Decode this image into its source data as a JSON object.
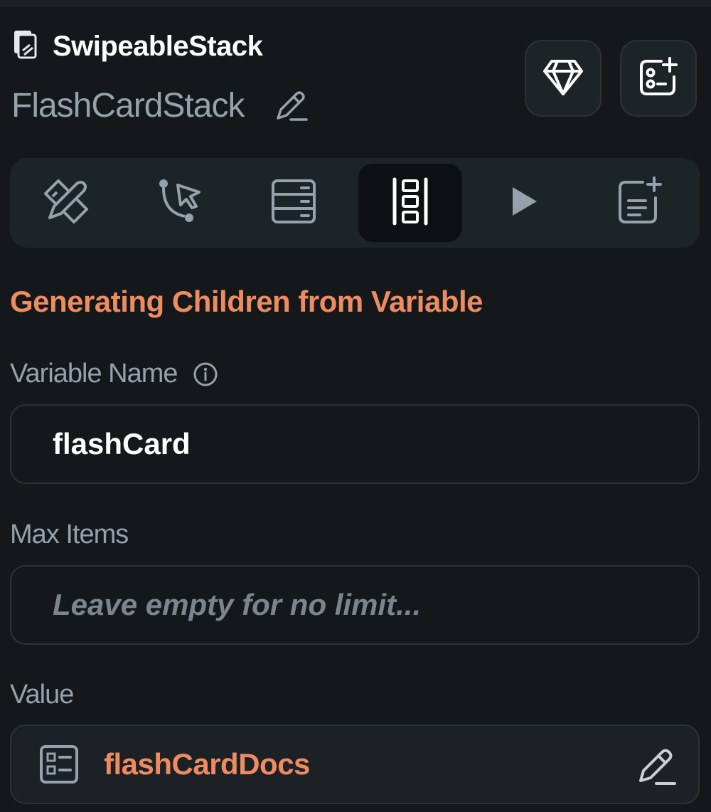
{
  "header": {
    "widget_type": "SwipeableStack",
    "widget_name": "FlashCardStack",
    "widget_type_icon": "swipeable-stack-icon",
    "rename_icon": "pencil-icon",
    "buttons": [
      {
        "icon": "diamond-icon"
      },
      {
        "icon": "add-widget-icon"
      }
    ]
  },
  "tabs": [
    {
      "icon": "ruler-pencil-icon",
      "active": false
    },
    {
      "icon": "action-flow-icon",
      "active": false
    },
    {
      "icon": "backend-query-icon",
      "active": false
    },
    {
      "icon": "generate-children-icon",
      "active": true
    },
    {
      "icon": "play-icon",
      "active": false
    },
    {
      "icon": "documentation-icon",
      "active": false
    }
  ],
  "section": {
    "title": "Generating Children from Variable"
  },
  "variable_name": {
    "label": "Variable Name",
    "value": "flashCard",
    "info_icon": "info-icon"
  },
  "max_items": {
    "label": "Max Items",
    "value": "",
    "placeholder": "Leave empty for no limit..."
  },
  "value_field": {
    "label": "Value",
    "value": "flashCardDocs",
    "icon": "document-list-icon",
    "edit_icon": "pencil-icon"
  },
  "colors": {
    "background": "#14181b",
    "panel": "#1d2428",
    "accent": "#ee8b60",
    "secondary_text": "#95a1ac",
    "primary_text": "#ffffff"
  }
}
